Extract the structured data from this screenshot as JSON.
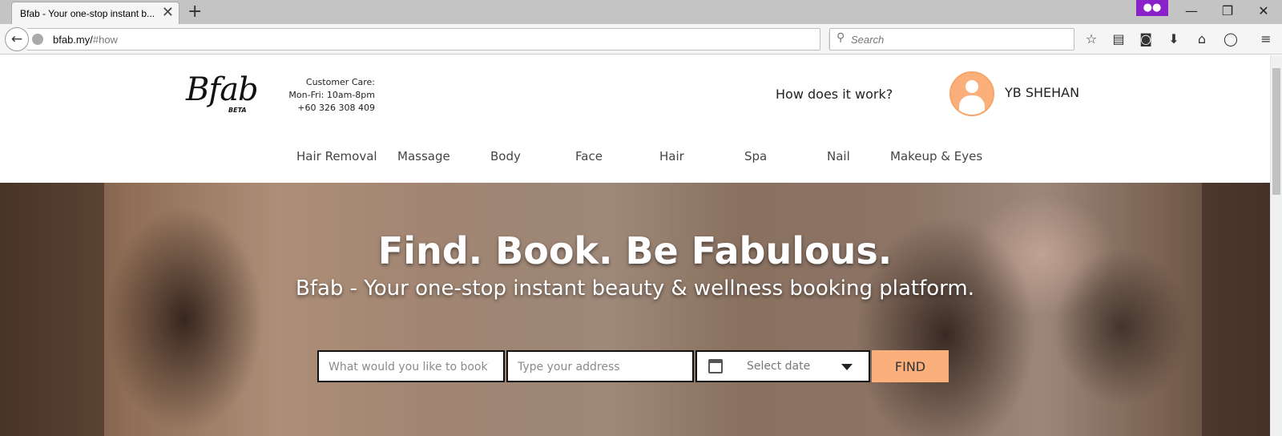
{
  "browser": {
    "tab_title": "Bfab - Your one-stop instant b...",
    "new_tab_symbol": "+",
    "close_symbol": "✕",
    "url_domain": "bfab.my/",
    "url_path": "#how",
    "search_placeholder": "Search",
    "icons": [
      "back-arrow-icon",
      "globe-icon",
      "reload-icon",
      "search-icon",
      "bookmark-star-icon",
      "reading-list-icon",
      "pocket-icon",
      "download-icon",
      "home-icon",
      "chat-icon",
      "menu-icon",
      "private-mask-icon"
    ]
  },
  "header": {
    "logo": "Bfab",
    "logo_badge": "BETA",
    "customer_care": {
      "label": "Customer Care:",
      "hours": "Mon-Fri: 10am-8pm",
      "phone": "+60 326 308 409"
    },
    "how_link": "How does it work?",
    "user_name": "YB SHEHAN"
  },
  "categories": [
    "Hair Removal",
    "Massage",
    "Body",
    "Face",
    "Hair",
    "Spa",
    "Nail",
    "Makeup & Eyes"
  ],
  "hero": {
    "headline": "Find. Book. Be Fabulous.",
    "subline": "Bfab - Your one-stop instant beauty & wellness booking platform.",
    "service_placeholder": "What would you like to book?",
    "address_placeholder": "Type your address",
    "date_placeholder": "Select date",
    "find_label": "FIND"
  },
  "colors": {
    "accent": "#fbb07c",
    "private_mask": "#8b21c9"
  }
}
